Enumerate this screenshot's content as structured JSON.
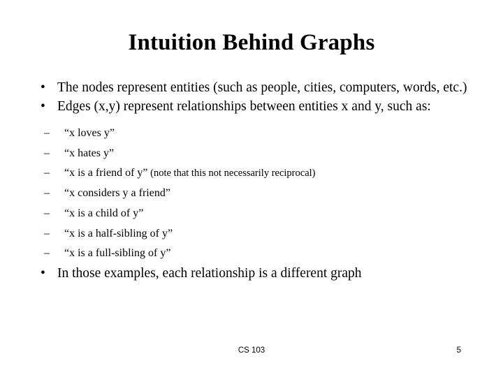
{
  "slide": {
    "title": "Intuition Behind Graphs",
    "bullets": [
      {
        "marker": "•",
        "text": "The nodes represent entities (such as people, cities, computers, words, etc.)"
      },
      {
        "marker": "•",
        "text": "Edges (x,y) represent relationships between entities x and y, such as:"
      }
    ],
    "sub_bullets": [
      {
        "marker": "–",
        "text": "“x loves y”",
        "note": ""
      },
      {
        "marker": "–",
        "text": "“x hates y”",
        "note": ""
      },
      {
        "marker": "–",
        "text": "“x is a friend of y”",
        "note": " (note that this not necessarily reciprocal)"
      },
      {
        "marker": "–",
        "text": "“x considers y a friend”",
        "note": ""
      },
      {
        "marker": "–",
        "text": "“x is a child of y”",
        "note": ""
      },
      {
        "marker": "–",
        "text": "“x is a half-sibling of y”",
        "note": ""
      },
      {
        "marker": "–",
        "text": "“x is a full-sibling of y”",
        "note": ""
      }
    ],
    "closing_bullet": {
      "marker": "•",
      "text": "In those examples, each relationship is a different graph"
    },
    "footer": {
      "course": "CS 103",
      "page_number": "5"
    }
  }
}
